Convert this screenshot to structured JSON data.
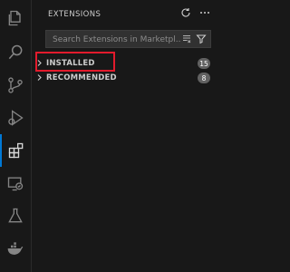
{
  "sidebar": {
    "title": "EXTENSIONS",
    "search_placeholder": "Search Extensions in Marketpl...",
    "sections": [
      {
        "label": "INSTALLED",
        "count": "15"
      },
      {
        "label": "RECOMMENDED",
        "count": "8"
      }
    ]
  },
  "activity_bar": {
    "items": [
      "explorer-icon",
      "search-icon",
      "source-control-icon",
      "run-debug-icon",
      "extensions-icon",
      "remote-explorer-icon",
      "testing-icon",
      "docker-icon"
    ]
  },
  "colors": {
    "background": "#181818",
    "highlight_border": "#e21b2c",
    "badge": "#616161"
  }
}
